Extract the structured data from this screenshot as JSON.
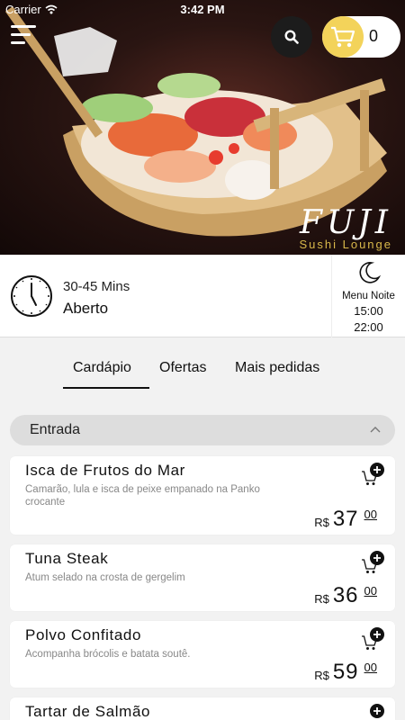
{
  "status_bar": {
    "carrier": "Carrier",
    "time": "3:42 PM"
  },
  "header": {
    "cart_count": "0",
    "logo_name": "FUJI",
    "logo_sub": "Sushi Lounge"
  },
  "info": {
    "time_range": "30-45 Mins",
    "status": "Aberto",
    "menu_label": "Menu Noite",
    "open_time": "15:00",
    "close_time": "22:00"
  },
  "tabs": [
    {
      "label": "Cardápio",
      "active": true
    },
    {
      "label": "Ofertas",
      "active": false
    },
    {
      "label": "Mais pedidas",
      "active": false
    }
  ],
  "category": {
    "label": "Entrada"
  },
  "items": [
    {
      "title": "Isca de Frutos do Mar",
      "desc": "Camarão, lula e isca de peixe empanado na Panko crocante",
      "currency": "R$",
      "price_int": "37",
      "price_dec": "00"
    },
    {
      "title": "Tuna Steak",
      "desc": "Atum selado na crosta de gergelim",
      "currency": "R$",
      "price_int": "36",
      "price_dec": "00"
    },
    {
      "title": "Polvo Confitado",
      "desc": "Acompanha brócolis e batata soutê.",
      "currency": "R$",
      "price_int": "59",
      "price_dec": "00"
    },
    {
      "title": "Tartar de Salmão",
      "desc": "",
      "currency": "",
      "price_int": "",
      "price_dec": ""
    }
  ],
  "colors": {
    "cart_accent": "#f3d35a",
    "logo_gold": "#d9b84a",
    "dark_button": "#1c1c1c"
  },
  "icons": [
    "menu-icon",
    "search-icon",
    "cart-icon",
    "clock-icon",
    "moon-icon",
    "chevron-up-icon",
    "add-to-cart-icon",
    "wifi-icon"
  ]
}
